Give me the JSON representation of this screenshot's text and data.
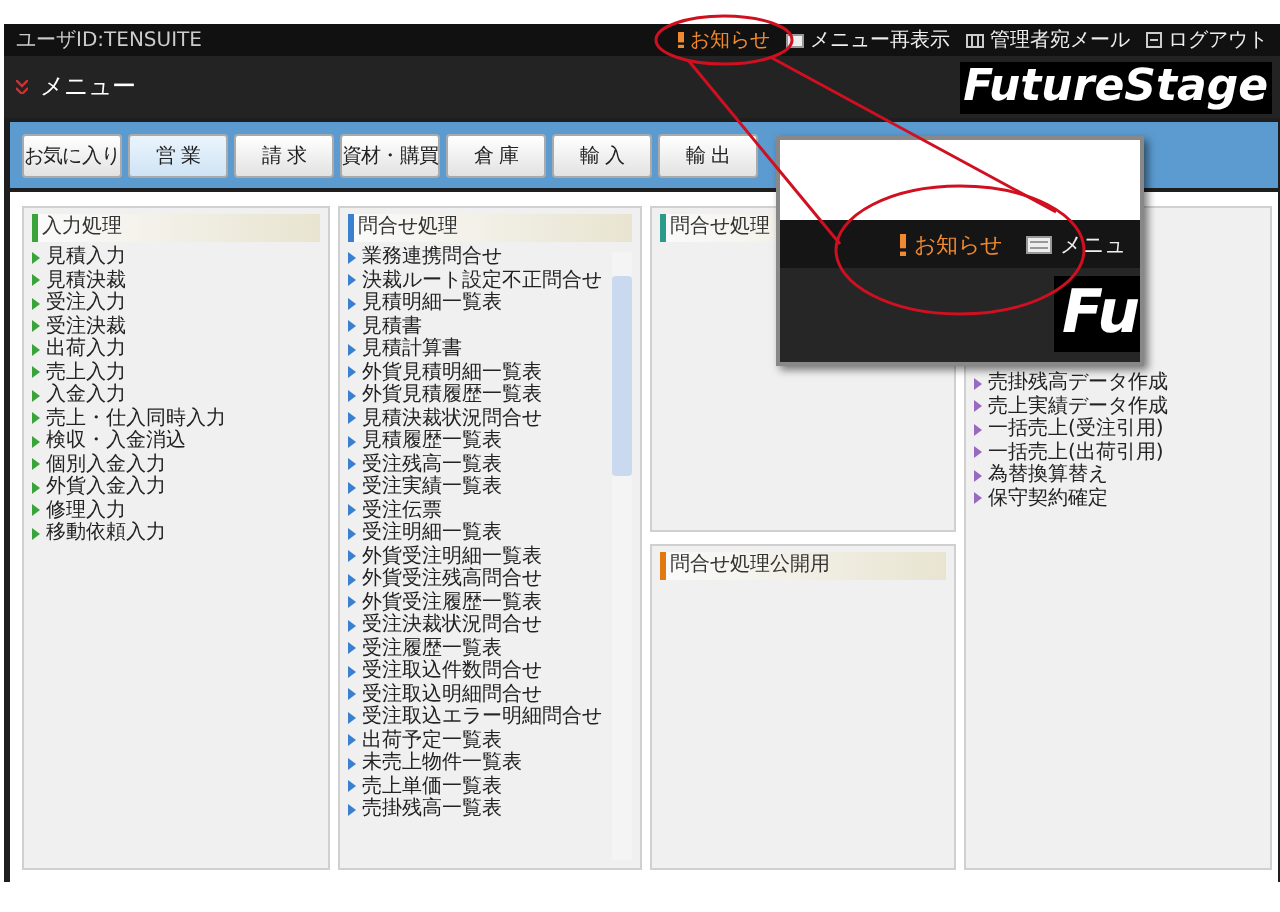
{
  "top_bar": {
    "user_id": "ユーザID:TENSUITE",
    "links": [
      {
        "kind": "notice",
        "label": "お知らせ"
      },
      {
        "kind": "menu",
        "label": "メニュー再表示"
      },
      {
        "kind": "mail",
        "label": "管理者宛メール"
      },
      {
        "kind": "logout",
        "label": "ログアウト"
      }
    ]
  },
  "header": {
    "title": "メニュー",
    "logo": "FutureStage"
  },
  "tabs": [
    {
      "label": "お気に入り",
      "selected": false
    },
    {
      "label": "営 業",
      "selected": true
    },
    {
      "label": "請 求",
      "selected": false
    },
    {
      "label": "資材・購買",
      "selected": false
    },
    {
      "label": "倉 庫",
      "selected": false
    },
    {
      "label": "輸 入",
      "selected": false
    },
    {
      "label": "輸 出",
      "selected": false
    }
  ],
  "panels": [
    {
      "title": "入力処理",
      "color": "#3aa33a",
      "items": [
        "見積入力",
        "見積決裁",
        "受注入力",
        "受注決裁",
        "出荷入力",
        "売上入力",
        "入金入力",
        "売上・仕入同時入力",
        "検収・入金消込",
        "個別入金入力",
        "外貨入金入力",
        "修理入力",
        "移動依頼入力"
      ]
    },
    {
      "title": "問合せ処理",
      "color": "#3a7fd0",
      "scroll": true,
      "items": [
        "業務連携問合せ",
        "決裁ルート設定不正問合せ",
        "見積明細一覧表",
        "見積書",
        "見積計算書",
        "外貨見積明細一覧表",
        "外貨見積履歴一覧表",
        "見積決裁状況問合せ",
        "見積履歴一覧表",
        "受注残高一覧表",
        "受注実績一覧表",
        "受注伝票",
        "受注明細一覧表",
        "外貨受注明細一覧表",
        "外貨受注残高問合せ",
        "外貨受注履歴一覧表",
        "受注決裁状況問合せ",
        "受注履歴一覧表",
        "受注取込件数問合せ",
        "受注取込明細問合せ",
        "受注取込エラー明細問合せ",
        "出荷予定一覧表",
        "未売上物件一覧表",
        "売上単価一覧表",
        "売掛残高一覧表"
      ]
    },
    {
      "title": "問合せ処理",
      "color": "#2a9a8a"
    },
    {
      "title": "問合せ処理公開用",
      "color": "#e07a10"
    },
    {
      "color": "#9a6ac0",
      "items": [
        "売掛残高データ作成",
        "売上実績データ作成",
        "一括売上(受注引用)",
        "一括売上(出荷引用)",
        "為替換算替え",
        "保守契約確定"
      ]
    }
  ],
  "magnifier": {
    "notice": "お知らせ",
    "menu": "メニュ",
    "logo": "Fu"
  }
}
